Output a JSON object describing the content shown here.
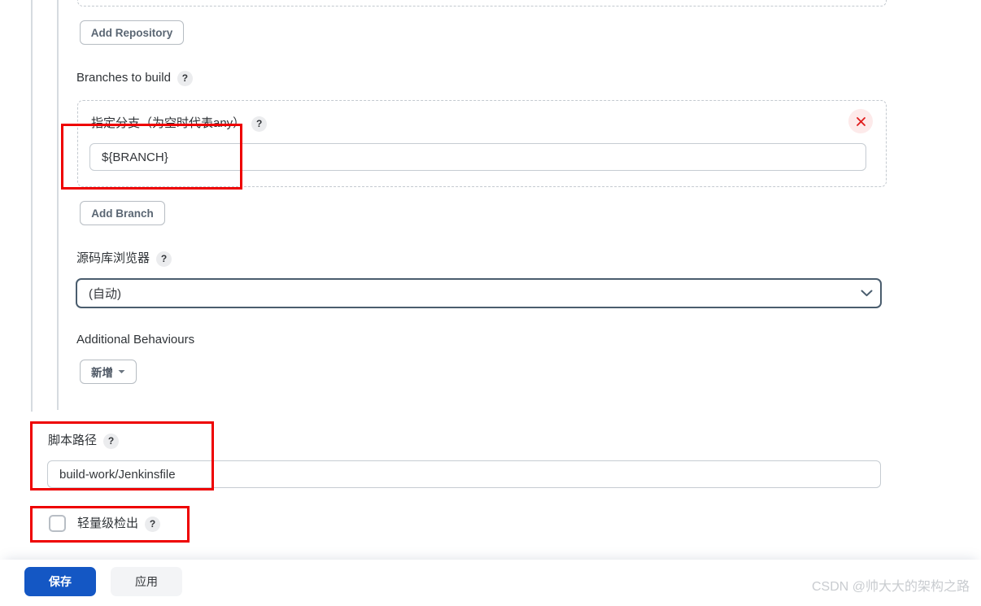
{
  "repository_section": {
    "add_repository_label": "Add Repository"
  },
  "branches": {
    "section_label": "Branches to build",
    "section_help": "?",
    "branch_spec_label": "指定分支（为空时代表any）",
    "branch_spec_help": "?",
    "branch_spec_value": "${BRANCH}",
    "delete_icon": "close-icon",
    "add_branch_label": "Add Branch"
  },
  "repo_browser": {
    "label": "源码库浏览器",
    "help": "?",
    "selected": "(自动)",
    "options": [
      "(自动)"
    ],
    "chevron_icon": "chevron-down-icon"
  },
  "additional_behaviours": {
    "label": "Additional Behaviours",
    "add_label": "新增",
    "caret_icon": "caret-down-icon"
  },
  "script_path": {
    "label": "脚本路径",
    "help": "?",
    "value": "build-work/Jenkinsfile"
  },
  "lightweight_checkout": {
    "label": "轻量级检出",
    "help": "?",
    "checked": false
  },
  "footer": {
    "save_label": "保存",
    "apply_label": "应用"
  },
  "watermark": {
    "text": "CSDN @帅大大的架构之路"
  },
  "colors": {
    "primary": "#1457c4",
    "annotation": "#ee0000",
    "border": "#c6ccd2",
    "select_border": "#4a5d6e"
  }
}
